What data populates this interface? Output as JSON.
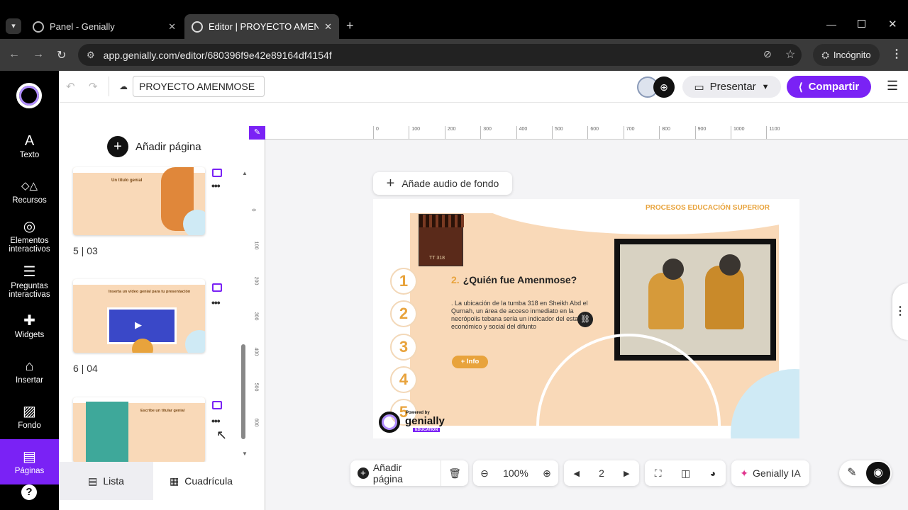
{
  "browser": {
    "tabs": [
      {
        "title": "Panel - Genially",
        "active": false
      },
      {
        "title": "Editor | PROYECTO AMENMOSE",
        "active": true
      }
    ],
    "url": "app.genially.com/editor/680396f9e42e89164df4154f",
    "incognito_label": "Incógnito"
  },
  "rail": {
    "items": [
      {
        "label": "Texto",
        "icon": "A"
      },
      {
        "label": "Recursos",
        "icon": "◇△"
      },
      {
        "label": "Elementos interactivos",
        "icon": "◎"
      },
      {
        "label": "Preguntas interactivas",
        "icon": "☰"
      },
      {
        "label": "Widgets",
        "icon": "✚"
      },
      {
        "label": "Insertar",
        "icon": "⌂"
      },
      {
        "label": "Fondo",
        "icon": "▨"
      },
      {
        "label": "Páginas",
        "icon": "▤"
      }
    ],
    "help_icon": "?"
  },
  "topbar": {
    "project_name": "PROYECTO AMENMOSE",
    "present_label": "Presentar",
    "share_label": "Compartir"
  },
  "panel": {
    "add_page_label": "Añadir página",
    "pages": [
      {
        "label": "5 |  03",
        "thumb_title": "Un título genial"
      },
      {
        "label": "6 |  04",
        "thumb_title": "Inserta un vídeo genial para tu presentación"
      },
      {
        "label": "",
        "thumb_title": "Escribe un titular genial"
      }
    ],
    "list_label": "Lista",
    "grid_label": "Cuadrícula"
  },
  "ruler": {
    "h_ticks": [
      "0",
      "100",
      "200",
      "300",
      "400",
      "500",
      "600",
      "700",
      "800",
      "900",
      "1000",
      "1100"
    ],
    "v_ticks": [
      "0",
      "100",
      "200",
      "300",
      "400",
      "500",
      "600"
    ]
  },
  "canvas": {
    "add_audio_label": "Añade audio de fondo",
    "slide": {
      "header": "PROCESOS EDUCACIÓN SUPERIOR",
      "thumb_caption": "TT 318",
      "numbers": [
        "1",
        "2",
        "3",
        "4",
        "5"
      ],
      "question_num": "2.",
      "question": "¿Quién fue Amenmose?",
      "body": ". La ubicación de la tumba 318 en Sheikh Abd el Qurnah, un área de acceso inmediato en la necrópolis tebana sería un indicador del estatus económico y social del difunto",
      "info_label": "+ Info",
      "powered_by": "Powered by",
      "brand": "genially",
      "edu": "EDUCATION"
    }
  },
  "bottombar": {
    "add_page_label": "Añadir página",
    "zoom": "100%",
    "page_number": "2",
    "ai_label": "Genially IA"
  },
  "colors": {
    "brand_purple": "#7a22f5",
    "peach": "#f9d9b8",
    "orange": "#e8a33c"
  }
}
